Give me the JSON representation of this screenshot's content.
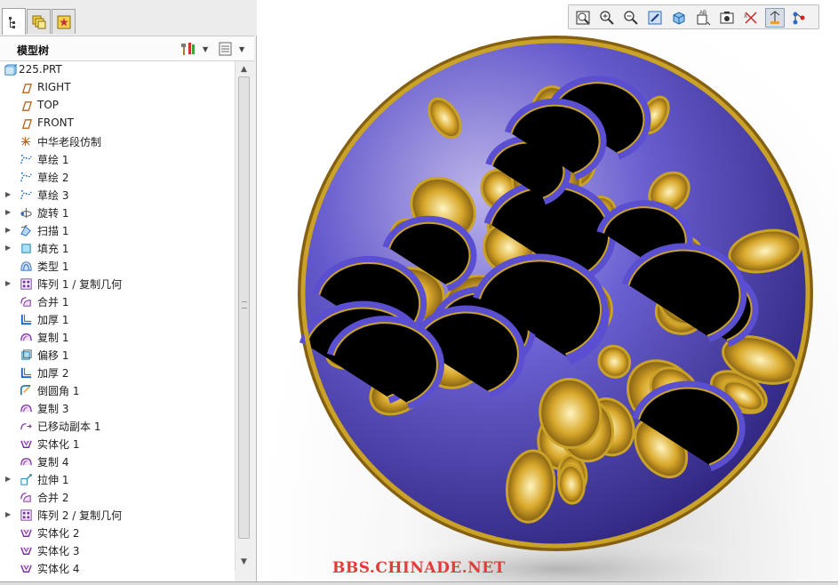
{
  "panel_tabs": [
    {
      "name": "model-tree-tab",
      "icon": "model-tree-icon"
    },
    {
      "name": "layers-tab",
      "icon": "layers-icon"
    },
    {
      "name": "favorites-tab",
      "icon": "star-icon"
    }
  ],
  "tree": {
    "title": "模型树",
    "settings_icon": "tools-icon",
    "columns_icon": "list-settings-icon",
    "items": [
      {
        "label": "225.PRT",
        "icon": "part-icon",
        "expandable": false,
        "root": true
      },
      {
        "label": "RIGHT",
        "icon": "datum-plane-icon",
        "expandable": false
      },
      {
        "label": "TOP",
        "icon": "datum-plane-icon",
        "expandable": false
      },
      {
        "label": "FRONT",
        "icon": "datum-plane-icon",
        "expandable": false
      },
      {
        "label": "中华老段仿制",
        "icon": "coordinate-system-icon",
        "expandable": false
      },
      {
        "label": "草绘 1",
        "icon": "sketch-icon",
        "expandable": false
      },
      {
        "label": "草绘 2",
        "icon": "sketch-icon",
        "expandable": false
      },
      {
        "label": "草绘 3",
        "icon": "sketch-icon",
        "expandable": true
      },
      {
        "label": "旋转 1",
        "icon": "revolve-icon",
        "expandable": true
      },
      {
        "label": "扫描 1",
        "icon": "sweep-icon",
        "expandable": true
      },
      {
        "label": "填充 1",
        "icon": "fill-icon",
        "expandable": true
      },
      {
        "label": "类型 1",
        "icon": "surface-icon",
        "expandable": false
      },
      {
        "label": "阵列 1 / 复制几何",
        "icon": "pattern-icon",
        "expandable": true
      },
      {
        "label": "合并 1",
        "icon": "merge-icon",
        "expandable": false
      },
      {
        "label": "加厚 1",
        "icon": "thicken-icon",
        "expandable": false
      },
      {
        "label": "复制 1",
        "icon": "copy-icon",
        "expandable": false
      },
      {
        "label": "偏移 1",
        "icon": "offset-icon",
        "expandable": false
      },
      {
        "label": "加厚 2",
        "icon": "thicken-icon",
        "expandable": false
      },
      {
        "label": "倒圆角 1",
        "icon": "round-icon",
        "expandable": false
      },
      {
        "label": "复制 3",
        "icon": "copy-icon",
        "expandable": false
      },
      {
        "label": "已移动副本 1",
        "icon": "moved-copy-icon",
        "expandable": false
      },
      {
        "label": "实体化 1",
        "icon": "solidify-icon",
        "expandable": false
      },
      {
        "label": "复制 4",
        "icon": "copy-icon",
        "expandable": false
      },
      {
        "label": "拉伸 1",
        "icon": "extrude-icon",
        "expandable": true
      },
      {
        "label": "合并 2",
        "icon": "merge-icon",
        "expandable": false
      },
      {
        "label": "阵列 2 / 复制几何",
        "icon": "pattern-icon",
        "expandable": true
      },
      {
        "label": "实体化 2",
        "icon": "solidify-icon",
        "expandable": false
      },
      {
        "label": "实体化 3",
        "icon": "solidify-icon",
        "expandable": false
      },
      {
        "label": "实体化 4",
        "icon": "solidify-icon",
        "expandable": false
      }
    ]
  },
  "toolbar": [
    {
      "name": "refit-button",
      "icon": "refit-icon"
    },
    {
      "name": "zoom-in-button",
      "icon": "zoom-in-icon"
    },
    {
      "name": "zoom-out-button",
      "icon": "zoom-out-icon"
    },
    {
      "name": "repaint-button",
      "icon": "repaint-icon"
    },
    {
      "name": "display-style-button",
      "icon": "display-style-icon"
    },
    {
      "name": "saved-views-button",
      "icon": "saved-views-icon"
    },
    {
      "name": "view-manager-button",
      "icon": "view-manager-icon"
    },
    {
      "name": "datum-display-button",
      "icon": "datum-display-icon"
    },
    {
      "name": "annotation-display-button",
      "icon": "annotation-display-icon"
    },
    {
      "name": "spin-center-button",
      "icon": "spin-center-icon"
    }
  ],
  "viewport": {
    "watermark": "BBS.CHINADE.NET",
    "model_colors": {
      "body": "#5a4fd0",
      "rim": "#c9a227"
    }
  },
  "colors": {
    "accent": "#2b6cc4",
    "plane": "#b5651d",
    "sketch": "#1a62c4",
    "feature": "#7a2fa0"
  }
}
